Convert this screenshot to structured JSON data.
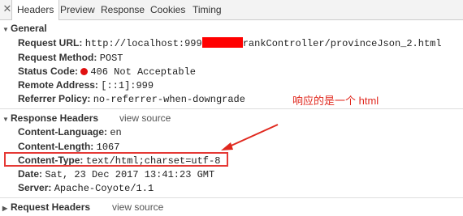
{
  "tabs": {
    "close": "✕",
    "items": [
      "Headers",
      "Preview",
      "Response",
      "Cookies",
      "Timing"
    ],
    "active": "Headers"
  },
  "general": {
    "title": "General",
    "request_url_key": "Request URL:",
    "request_url_prefix": "http://localhost:999",
    "request_url_suffix": "rankController/provinceJson_2.html",
    "request_method_key": "Request Method:",
    "request_method": "POST",
    "status_code_key": "Status Code:",
    "status_code": "406 Not Acceptable",
    "remote_address_key": "Remote Address:",
    "remote_address": "[::1]:999",
    "referrer_policy_key": "Referrer Policy:",
    "referrer_policy": "no-referrer-when-downgrade"
  },
  "response_headers": {
    "title": "Response Headers",
    "view_source": "view source",
    "content_language_key": "Content-Language:",
    "content_language": "en",
    "content_length_key": "Content-Length:",
    "content_length": "1067",
    "content_type_key": "Content-Type:",
    "content_type": "text/html;charset=utf-8",
    "date_key": "Date:",
    "date": "Sat, 23 Dec 2017 13:41:23 GMT",
    "server_key": "Server:",
    "server": "Apache-Coyote/1.1"
  },
  "request_headers": {
    "title": "Request Headers",
    "view_source": "view source"
  },
  "annotation": "响应的是一个 html",
  "colors": {
    "redaction": "#ff0000",
    "annotation": "#e0281e",
    "status_error": "#e01010"
  }
}
